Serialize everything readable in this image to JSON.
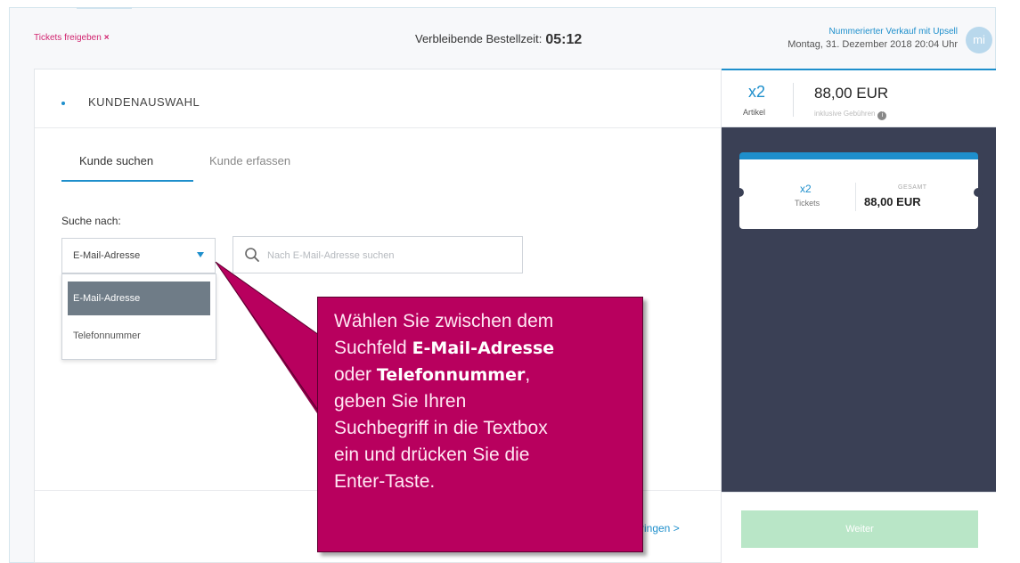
{
  "header": {
    "release_label": "Tickets freigeben",
    "release_icon": "×",
    "timer_label": "Verbleibende Bestellzeit:",
    "timer_value": "05:12",
    "sales_mode": "Nummerierter Verkauf mit Upsell",
    "datetime": "Montag, 31. Dezember 2018 20:04 Uhr",
    "avatar_initials": "mi"
  },
  "section": {
    "title": "KUNDENAUSWAHL"
  },
  "tabs": [
    {
      "label": "Kunde suchen",
      "active": true
    },
    {
      "label": "Kunde erfassen",
      "active": false
    }
  ],
  "search": {
    "label": "Suche nach:",
    "field_selected": "E-Mail-Adresse",
    "options": [
      "E-Mail-Adresse",
      "Telefonnummer"
    ],
    "placeholder": "Nach E-Mail-Adresse suchen"
  },
  "summary": {
    "quantity": "x2",
    "quantity_label": "Artikel",
    "price": "88,00 EUR",
    "fees_note": "inklusive Gebühren"
  },
  "ticket_card": {
    "quantity": "x2",
    "quantity_label": "Tickets",
    "total_label": "GESAMT",
    "total": "88,00 EUR"
  },
  "footer": {
    "next_link": "ringen >",
    "next_button": "Weiter"
  },
  "callout": {
    "line1": "Wählen Sie zwischen dem",
    "line2a": "Suchfeld ",
    "line2b": "E-Mail-Adresse",
    "line3a": "oder ",
    "line3b": "Telefonnummer",
    "line3c": ",",
    "line4": "geben Sie Ihren",
    "line5": "Suchbegriff in die Textbox",
    "line6": "ein und drücken Sie die",
    "line7": "Enter-Taste."
  },
  "colors": {
    "accent": "#1e8fcc",
    "release": "#d1246f",
    "dark_panel": "#3a4055",
    "callout_bg": "#b8005e",
    "button_disabled": "#b9e6c7"
  }
}
